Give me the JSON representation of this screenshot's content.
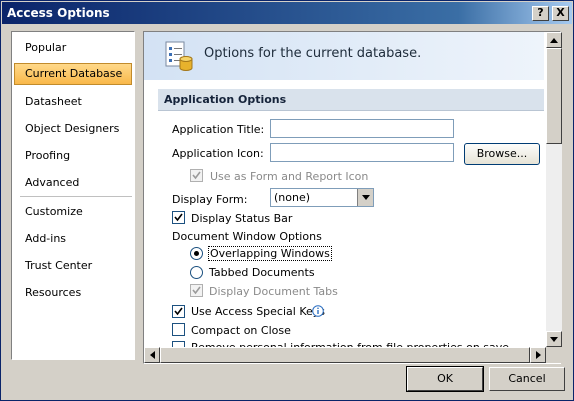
{
  "window": {
    "title": "Access Options",
    "help_btn": "?",
    "close_btn": "X"
  },
  "nav": {
    "items": [
      {
        "label": "Popular"
      },
      {
        "label": "Current Database"
      },
      {
        "label": "Datasheet"
      },
      {
        "label": "Object Designers"
      },
      {
        "label": "Proofing"
      },
      {
        "label": "Advanced"
      },
      {
        "label": "Customize"
      },
      {
        "label": "Add-ins"
      },
      {
        "label": "Trust Center"
      },
      {
        "label": "Resources"
      }
    ],
    "active_index": 1
  },
  "content": {
    "header": "Options for the current database.",
    "section_title": "Application Options",
    "app_title_label": "Application Title:",
    "app_title_value": "",
    "app_icon_label": "Application Icon:",
    "app_icon_value": "",
    "browse_button": "Browse...",
    "use_as_form_icon": "Use as Form and Report Icon",
    "display_form_label": "Display Form:",
    "display_form_value": "(none)",
    "display_status_bar": "Display Status Bar",
    "doc_window_options": "Document Window Options",
    "overlapping_windows": "Overlapping Windows",
    "tabbed_documents": "Tabbed Documents",
    "display_document_tabs": "Display Document Tabs",
    "use_access_special_keys": "Use Access Special Keys",
    "compact_on_close": "Compact on Close",
    "remove_personal_info": "Remove personal information from file properties on save"
  },
  "footer": {
    "ok": "OK",
    "cancel": "Cancel"
  },
  "colors": {
    "title_bar": "#0a246a",
    "active_nav": "#f9b84a",
    "section_bar": "#d9e2ec"
  }
}
